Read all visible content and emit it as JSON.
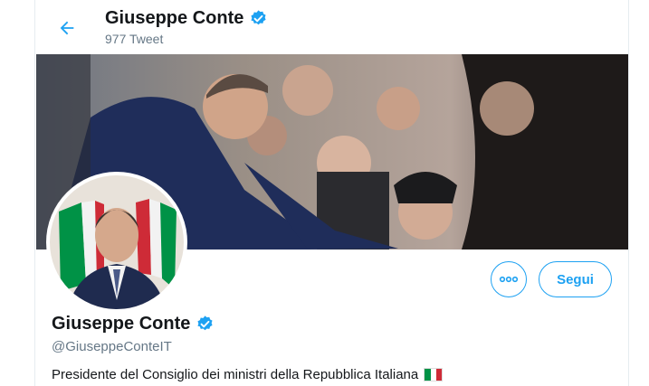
{
  "header": {
    "name": "Giuseppe Conte",
    "tweet_count": "977 Tweet"
  },
  "profile": {
    "name": "Giuseppe Conte",
    "handle": "@GiuseppeConteIT",
    "bio": "Presidente del Consiglio dei ministri della Repubblica Italiana",
    "bio_flag": "italy-flag-icon"
  },
  "actions": {
    "follow_label": "Segui",
    "more_icon": "more-dots-icon"
  },
  "icons": {
    "back": "arrow-left-icon",
    "verified": "verified-badge-icon"
  },
  "colors": {
    "accent": "#1da1f2",
    "text_primary": "#14171a",
    "text_secondary": "#657786",
    "flag_green": "#009246",
    "flag_white": "#ffffff",
    "flag_red": "#ce2b37"
  }
}
